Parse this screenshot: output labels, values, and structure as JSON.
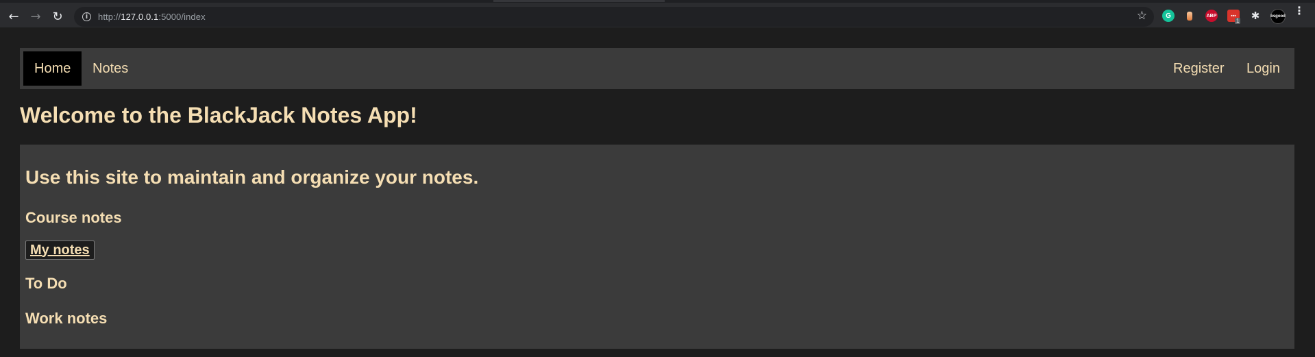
{
  "browser": {
    "url_scheme": "http://",
    "url_host": "127.0.0.1",
    "url_rest": ":5000/index",
    "back_icon": "←",
    "forward_icon": "→",
    "reload_icon": "↻",
    "info_icon": "i",
    "star_icon": "☆",
    "extensions": {
      "grammarly": "G",
      "abp": "ABP",
      "red_ext": "▪▪▪",
      "red_ext_badge": "1",
      "puzzle_icon": "✱",
      "avatar_text": "bsgood"
    },
    "menu_icon": "⋮"
  },
  "nav": {
    "home": "Home",
    "notes": "Notes",
    "register": "Register",
    "login": "Login"
  },
  "main": {
    "title": "Welcome to the BlackJack Notes App!",
    "subtitle": "Use this site to maintain and organize your notes.",
    "sections": {
      "course": "Course notes",
      "my_notes": "My notes",
      "todo": "To Do",
      "work": "Work notes"
    }
  },
  "colors": {
    "background": "#1d1d1d",
    "panel": "#3b3b3b",
    "text": "#f5deb3",
    "active_nav": "#000000"
  }
}
